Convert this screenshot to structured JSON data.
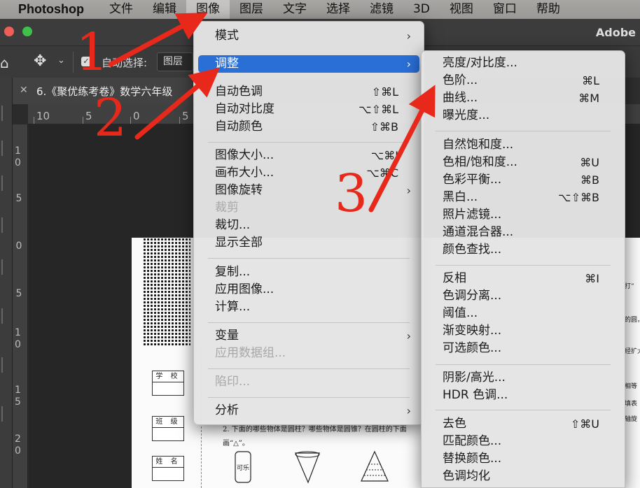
{
  "menubar": {
    "app_name": "Photoshop",
    "items": [
      "文件",
      "编辑",
      "图像",
      "图层",
      "文字",
      "选择",
      "滤镜",
      "3D",
      "视图",
      "窗口",
      "帮助"
    ],
    "active_index": 2
  },
  "window": {
    "brand": "Adobe"
  },
  "options_bar": {
    "auto_select_label": "自动选择:",
    "auto_select_value": "图层"
  },
  "document": {
    "tab_title": "6.《聚优练考卷》数学六年级",
    "ruler_h": [
      "10",
      "5",
      "0",
      "5"
    ],
    "ruler_v": [
      "10",
      "5",
      "0",
      "5",
      "10",
      "15",
      "20"
    ],
    "form_labels": [
      "学 校",
      "班 级",
      "姓 名"
    ],
    "question_text": "2. 下面的哪些物体是圆柱？哪些物体是圆锥？在圆柱的下面画“△”。",
    "can_label": "可乐",
    "side_text": [
      "打“",
      "的圆，",
      "经扩大",
      "相等",
      "填表",
      "轴旋"
    ]
  },
  "image_menu": {
    "items": [
      {
        "label": "模式",
        "shortcut": "",
        "submenu": true
      },
      {
        "label": "调整",
        "shortcut": "",
        "submenu": true,
        "highlighted": true
      },
      {
        "label": "自动色调",
        "shortcut": "⇧⌘L"
      },
      {
        "label": "自动对比度",
        "shortcut": "⌥⇧⌘L"
      },
      {
        "label": "自动颜色",
        "shortcut": "⇧⌘B"
      },
      {
        "label": "图像大小...",
        "shortcut": "⌥⌘I"
      },
      {
        "label": "画布大小...",
        "shortcut": "⌥⌘C"
      },
      {
        "label": "图像旋转",
        "shortcut": "",
        "submenu": true
      },
      {
        "label": "裁剪",
        "shortcut": "",
        "disabled": true
      },
      {
        "label": "裁切...",
        "shortcut": ""
      },
      {
        "label": "显示全部",
        "shortcut": ""
      },
      {
        "label": "复制...",
        "shortcut": ""
      },
      {
        "label": "应用图像...",
        "shortcut": ""
      },
      {
        "label": "计算...",
        "shortcut": ""
      },
      {
        "label": "变量",
        "shortcut": "",
        "submenu": true
      },
      {
        "label": "应用数据组...",
        "shortcut": "",
        "disabled": true
      },
      {
        "label": "陷印...",
        "shortcut": "",
        "disabled": true
      },
      {
        "label": "分析",
        "shortcut": "",
        "submenu": true
      }
    ]
  },
  "adjust_menu": {
    "items": [
      {
        "label": "亮度/对比度...",
        "shortcut": ""
      },
      {
        "label": "色阶...",
        "shortcut": "⌘L"
      },
      {
        "label": "曲线...",
        "shortcut": "⌘M"
      },
      {
        "label": "曝光度...",
        "shortcut": ""
      },
      {
        "label": "自然饱和度...",
        "shortcut": ""
      },
      {
        "label": "色相/饱和度...",
        "shortcut": "⌘U"
      },
      {
        "label": "色彩平衡...",
        "shortcut": "⌘B"
      },
      {
        "label": "黑白...",
        "shortcut": "⌥⇧⌘B"
      },
      {
        "label": "照片滤镜...",
        "shortcut": ""
      },
      {
        "label": "通道混合器...",
        "shortcut": ""
      },
      {
        "label": "颜色查找...",
        "shortcut": ""
      },
      {
        "label": "反相",
        "shortcut": "⌘I"
      },
      {
        "label": "色调分离...",
        "shortcut": ""
      },
      {
        "label": "阈值...",
        "shortcut": ""
      },
      {
        "label": "渐变映射...",
        "shortcut": ""
      },
      {
        "label": "可选颜色...",
        "shortcut": ""
      },
      {
        "label": "阴影/高光...",
        "shortcut": ""
      },
      {
        "label": "HDR 色调...",
        "shortcut": ""
      },
      {
        "label": "去色",
        "shortcut": "⇧⌘U"
      },
      {
        "label": "匹配颜色...",
        "shortcut": ""
      },
      {
        "label": "替换颜色...",
        "shortcut": ""
      },
      {
        "label": "色调均化",
        "shortcut": ""
      }
    ]
  },
  "annotations": {
    "numbers": [
      "1",
      "2",
      "3"
    ],
    "color": "#e8281a"
  },
  "colors": {
    "highlight": "#2a6fd6",
    "menubar": "#a09e9c"
  }
}
